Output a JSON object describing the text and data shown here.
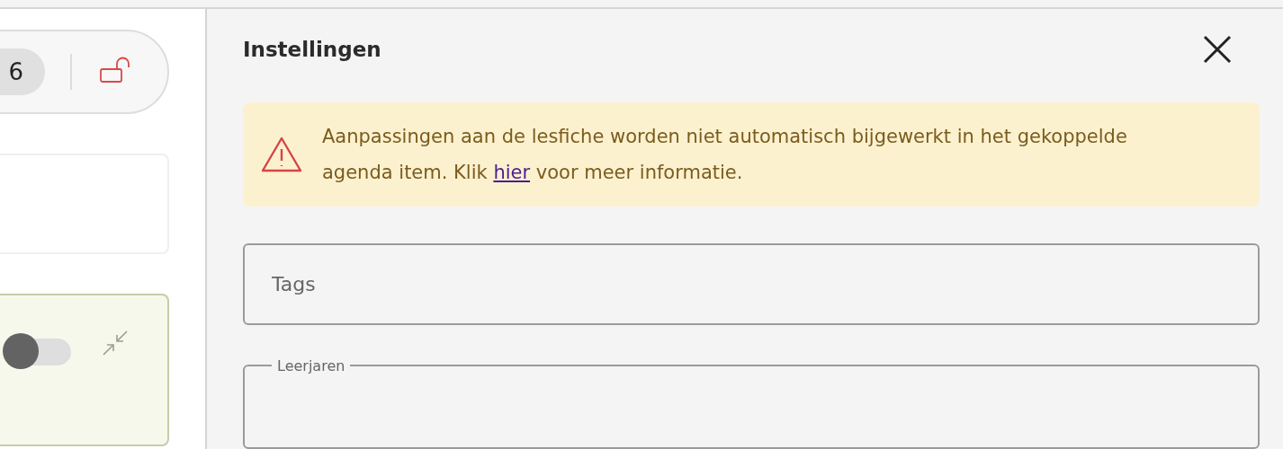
{
  "left_panel": {
    "chip": "6",
    "locked": false,
    "toggle": {
      "on": false
    }
  },
  "settings": {
    "title": "Instellingen",
    "alert": {
      "text": " Aanpassingen aan de lesfiche worden niet automatisch bijgewerkt in het gekoppelde agenda item. Klik ",
      "link": "hier",
      "text_after": " voor meer informatie."
    },
    "tags_field": {
      "placeholder": "Tags"
    },
    "grades_field": {
      "label": "Leerjaren"
    }
  }
}
